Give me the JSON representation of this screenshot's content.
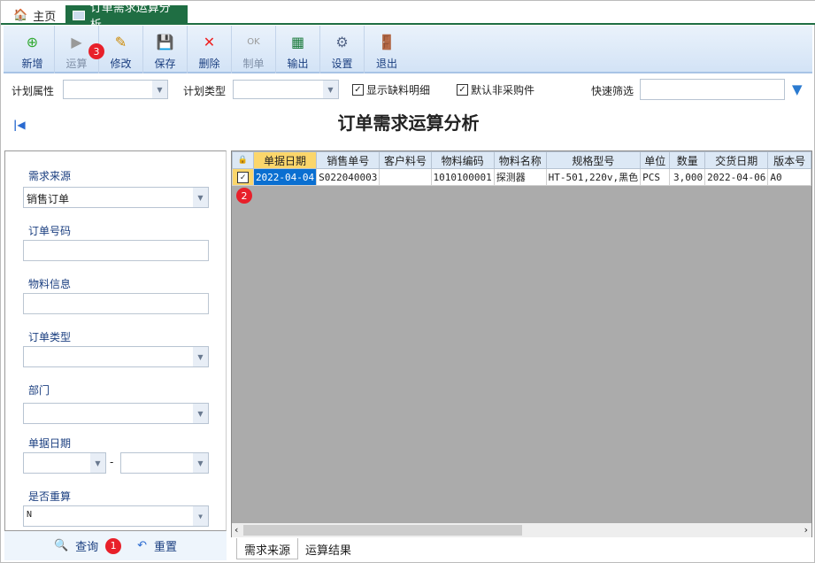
{
  "tabs": [
    {
      "label": "主页",
      "icon": "home-icon"
    },
    {
      "label": "订单需求运算分析",
      "icon": "grid-icon"
    }
  ],
  "toolbar": [
    {
      "label": "新增",
      "icon": "new-doc-icon",
      "enabled": true
    },
    {
      "label": "运算",
      "icon": "run-icon",
      "enabled": false
    },
    {
      "label": "修改",
      "icon": "edit-icon",
      "enabled": true
    },
    {
      "label": "保存",
      "icon": "save-icon",
      "enabled": true
    },
    {
      "label": "删除",
      "icon": "delete-icon",
      "enabled": true
    },
    {
      "label": "制单",
      "icon": "ok-doc-icon",
      "enabled": false
    },
    {
      "label": "输出",
      "icon": "excel-export-icon",
      "enabled": true
    },
    {
      "label": "设置",
      "icon": "settings-icon",
      "enabled": true
    },
    {
      "label": "退出",
      "icon": "exit-door-icon",
      "enabled": true
    }
  ],
  "badges": {
    "query": "1",
    "row": "2",
    "toolbar": "3"
  },
  "filter": {
    "plan_attr_label": "计划属性",
    "plan_attr_value": "",
    "plan_type_label": "计划类型",
    "plan_type_value": "",
    "show_shortage": "显示缺料明细",
    "default_non_purchase": "默认非采购件",
    "quick_filter_label": "快速筛选",
    "quick_filter_value": ""
  },
  "page_title": "订单需求运算分析",
  "form": {
    "demand_source_label": "需求来源",
    "demand_source_value": "销售订单",
    "order_no_label": "订单号码",
    "material_info_label": "物料信息",
    "order_type_label": "订单类型",
    "dept_label": "部门",
    "doc_date_label": "单据日期",
    "date_sep": "-",
    "recalc_label": "是否重算",
    "recalc_value": "N",
    "query_label": "查询",
    "reset_label": "重置"
  },
  "grid": {
    "columns": [
      "单据日期",
      "销售单号",
      "客户料号",
      "物料编码",
      "物料名称",
      "规格型号",
      "单位",
      "数量",
      "交货日期",
      "版本号"
    ],
    "rows": [
      [
        "2022-04-04",
        "S022040003",
        "",
        "1010100001",
        "探测器",
        "HT-501,220v,黑色",
        "PCS",
        "3,000",
        "2022-04-06",
        "A0"
      ]
    ]
  },
  "bottom_tabs": [
    "需求来源",
    "运算结果"
  ]
}
